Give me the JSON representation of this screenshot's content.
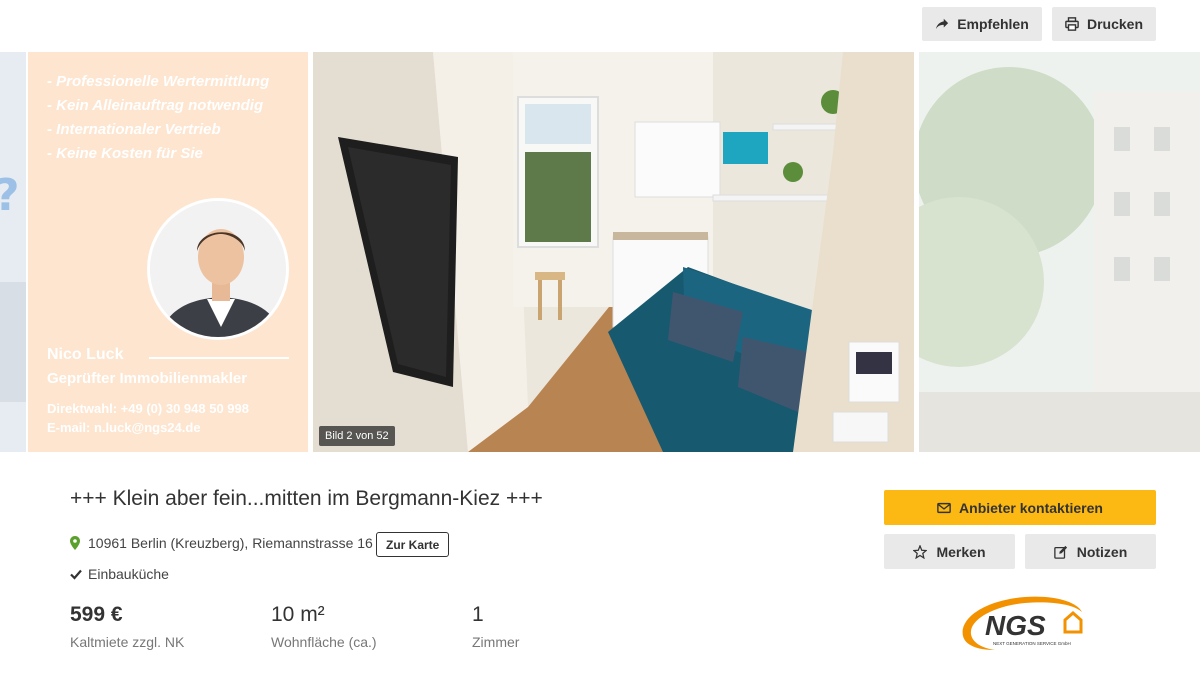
{
  "toolbar": {
    "recommend_label": "Empfehlen",
    "print_label": "Drucken"
  },
  "gallery": {
    "counter": "Bild 2 von 52",
    "agent_card": {
      "bullets": [
        "- Professionelle Wertermittlung",
        "- Kein Alleinauftrag notwendig",
        "- Internationaler Vertrieb",
        "- Keine Kosten für Sie"
      ],
      "name": "Nico Luck",
      "title": "Geprüfter Immobilienmakler",
      "phone": "Direktwahl: +49 (0) 30 948 50 998",
      "email": "E-mail: n.luck@ngs24.de"
    }
  },
  "listing": {
    "title": "+++ Klein aber fein...mitten im Bergmann-Kiez +++",
    "address": "10961 Berlin (Kreuzberg), Riemannstrasse 16",
    "map_button": "Zur Karte",
    "feature": "Einbauküche",
    "stats": [
      {
        "value": "599 €",
        "label": "Kaltmiete zzgl. NK"
      },
      {
        "value": "10 m²",
        "label": "Wohnfläche (ca.)"
      },
      {
        "value": "1",
        "label": "Zimmer"
      }
    ]
  },
  "actions": {
    "contact_label": "Anbieter kontaktieren",
    "save_label": "Merken",
    "notes_label": "Notizen"
  },
  "logo": {
    "text": "NGS",
    "subtext": "NEXT GENERATION SERVICE GmbH"
  },
  "colors": {
    "accent": "#fdb913",
    "pin": "#5aa02c",
    "logo_orange": "#f39200",
    "agent_panel": "#fde5cf"
  }
}
